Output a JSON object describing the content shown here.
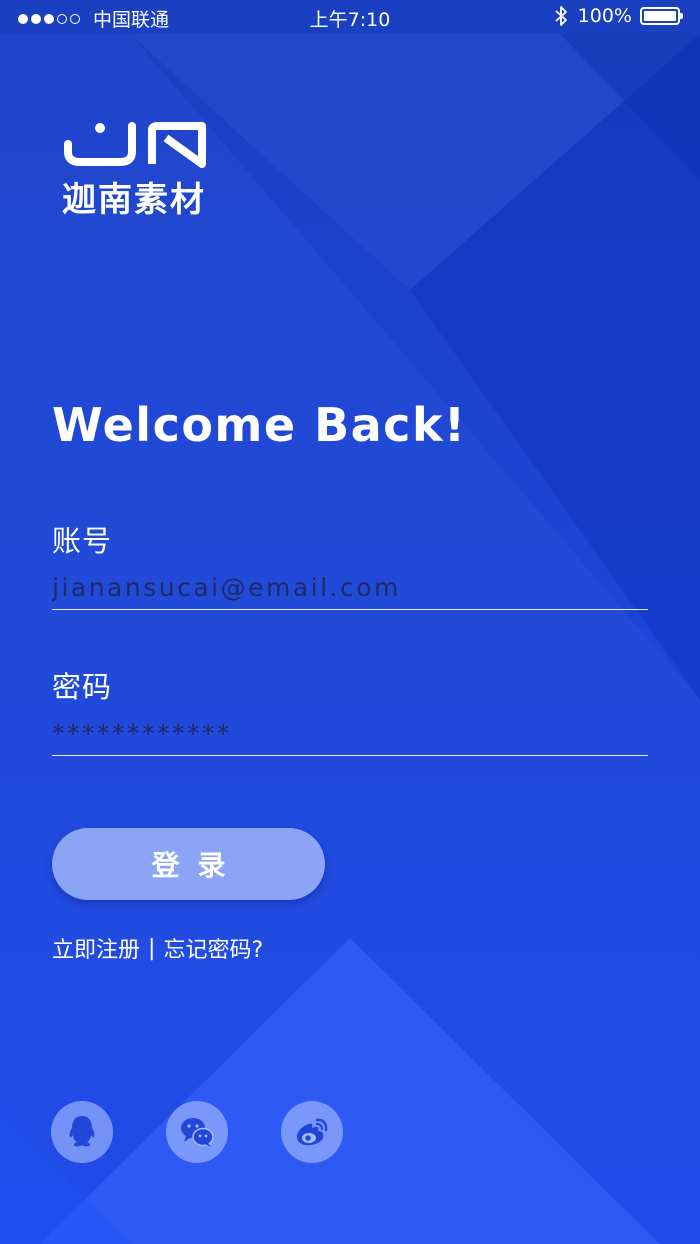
{
  "status_bar": {
    "carrier": "中国联通",
    "time": "上午7:10",
    "battery": "100%",
    "battery_level": 1.0
  },
  "logo": {
    "text": "迦南素材"
  },
  "title": "Welcome Back!",
  "account": {
    "label": "账号",
    "value": "jianansucai@email.com"
  },
  "password": {
    "label": "密码",
    "value": "************"
  },
  "login_button": {
    "label": "登录"
  },
  "links": {
    "register": "立即注册",
    "separator": "|",
    "forgot": "忘记密码?"
  },
  "social": [
    {
      "icon": "qq-icon"
    },
    {
      "icon": "wechat-icon"
    },
    {
      "icon": "weibo-icon"
    }
  ],
  "colors": {
    "background_top": "#1a3fc0",
    "background_bottom": "#1d48f0",
    "button": "#8ca4f6",
    "input_text": "#1f2a66"
  }
}
